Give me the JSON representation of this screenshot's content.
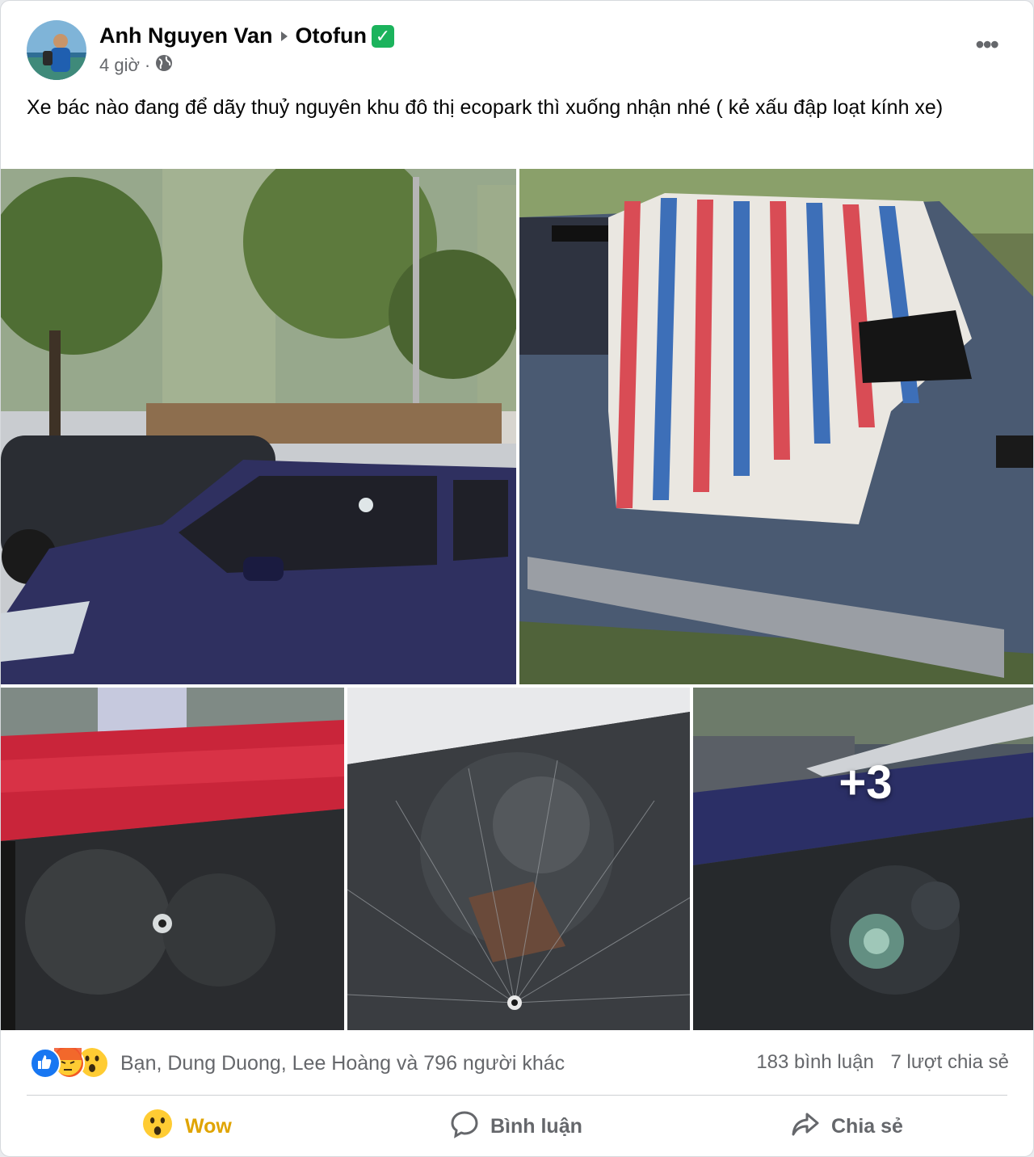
{
  "post": {
    "author": "Anh Nguyen Van",
    "group": "Otofun",
    "time": "4 giờ",
    "dot": "·",
    "caption": "Xe bác nào đang để dãy thuỷ nguyên khu đô thị ecopark thì xuống nhận nhé ( kẻ xấu đập loạt kính xe)",
    "more_label": "•••"
  },
  "photos": {
    "extra_count": "+3"
  },
  "reactions": {
    "names": "Bạn, Dung Duong, Lee Hoàng và 796 người khác",
    "comments": "183 bình luận",
    "shares": "7 lượt chia sẻ",
    "icons": [
      "like-icon",
      "angry-icon",
      "wow-icon"
    ]
  },
  "actions": {
    "wow_label": "Wow",
    "comment_label": "Bình luận",
    "share_label": "Chia sẻ"
  },
  "colors": {
    "wow_active": "#e0a400",
    "secondary_text": "#65676b",
    "like_blue": "#1877f2",
    "verified_green": "#1bb35c"
  }
}
